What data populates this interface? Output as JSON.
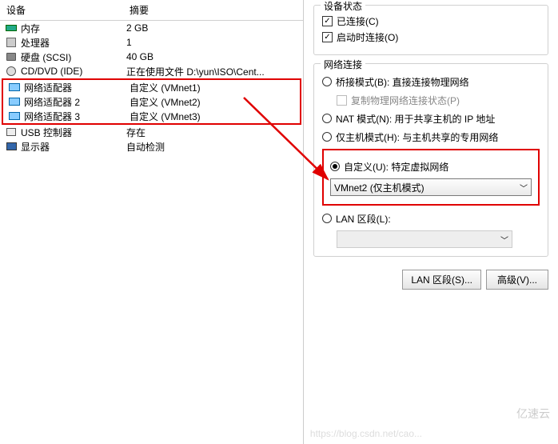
{
  "left": {
    "headers": {
      "device": "设备",
      "summary": "摘要"
    },
    "rows": [
      {
        "name": "内存",
        "summary": "2 GB",
        "icon": "mem"
      },
      {
        "name": "处理器",
        "summary": "1",
        "icon": "cpu"
      },
      {
        "name": "硬盘 (SCSI)",
        "summary": "40 GB",
        "icon": "hdd"
      },
      {
        "name": "CD/DVD (IDE)",
        "summary": "正在使用文件 D:\\yun\\ISO\\Cent...",
        "icon": "cd"
      }
    ],
    "highlighted": [
      {
        "name": "网络适配器",
        "summary": "自定义 (VMnet1)",
        "icon": "net"
      },
      {
        "name": "网络适配器 2",
        "summary": "自定义 (VMnet2)",
        "icon": "net"
      },
      {
        "name": "网络适配器 3",
        "summary": "自定义 (VMnet3)",
        "icon": "net"
      }
    ],
    "rows2": [
      {
        "name": "USB 控制器",
        "summary": "存在",
        "icon": "usb"
      },
      {
        "name": "显示器",
        "summary": "自动检测",
        "icon": "display"
      }
    ]
  },
  "right": {
    "status_legend": "设备状态",
    "connected": "已连接(C)",
    "connect_poweron": "启动时连接(O)",
    "netconn_legend": "网络连接",
    "bridged": "桥接模式(B): 直接连接物理网络",
    "replicate": "复制物理网络连接状态(P)",
    "nat": "NAT 模式(N): 用于共享主机的 IP 地址",
    "hostonly": "仅主机模式(H): 与主机共享的专用网络",
    "custom": "自定义(U): 特定虚拟网络",
    "custom_value": "VMnet2 (仅主机模式)",
    "lan": "LAN 区段(L):",
    "btn_lan": "LAN 区段(S)...",
    "btn_adv": "高级(V)..."
  },
  "watermark1": "亿速云",
  "watermark2": "https://blog.csdn.net/cao..."
}
